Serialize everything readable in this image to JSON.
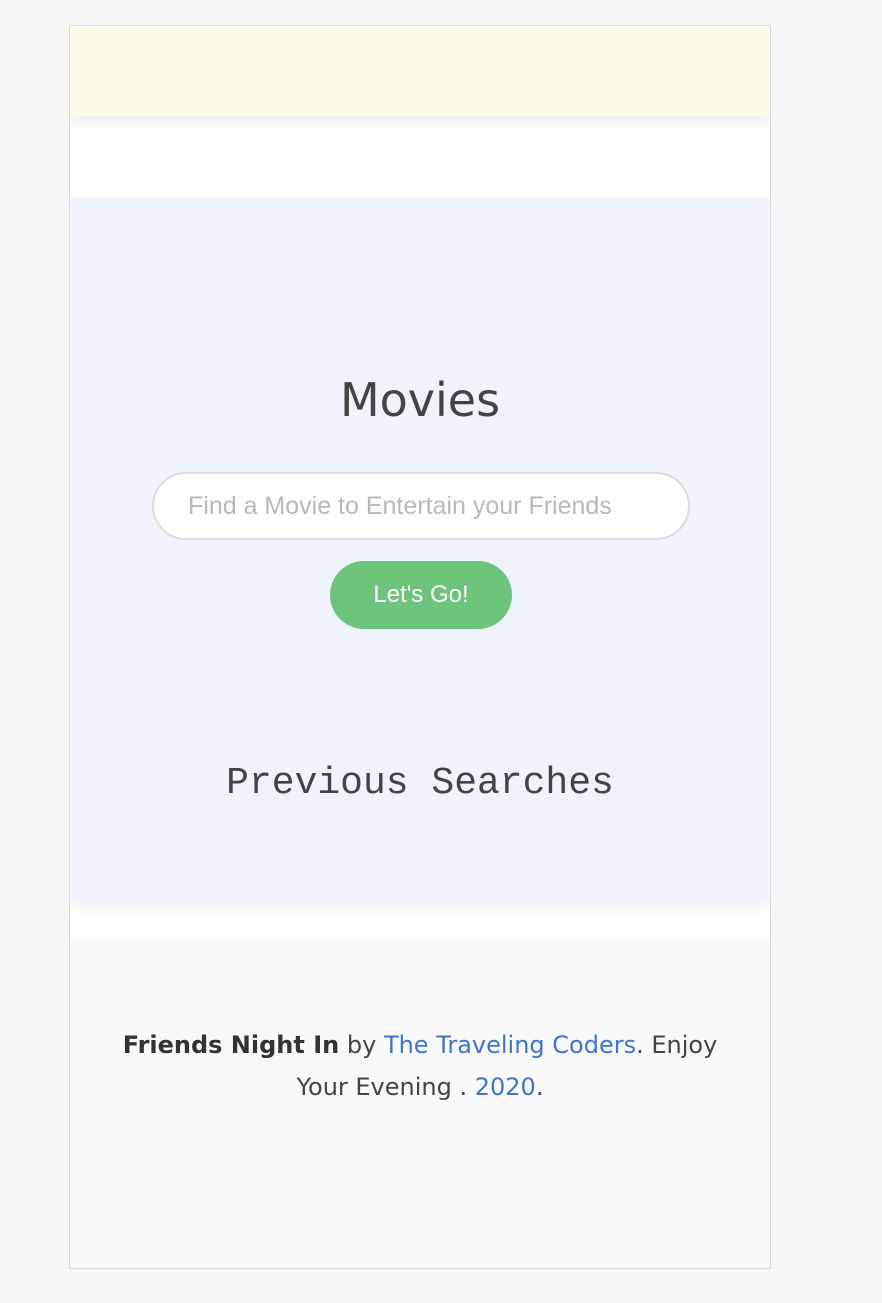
{
  "search_section": {
    "title": "Movies",
    "input_placeholder": "Find a Movie to Entertain your Friends",
    "input_value": "",
    "button_label": "Let's Go!",
    "previous_title": "Previous Searches"
  },
  "footer": {
    "site_name": "Friends Night In",
    "by_text": " by ",
    "author_link": "The Traveling Coders",
    "after_author": ". Enjoy Your Evening . ",
    "year_link": "2020",
    "end_text": "."
  },
  "colors": {
    "banner": "#fffbeb",
    "section_bg": "#eff3fb",
    "button": "#6cc57b",
    "link": "#3f76cc",
    "footer_bg": "#f9f9f9"
  }
}
